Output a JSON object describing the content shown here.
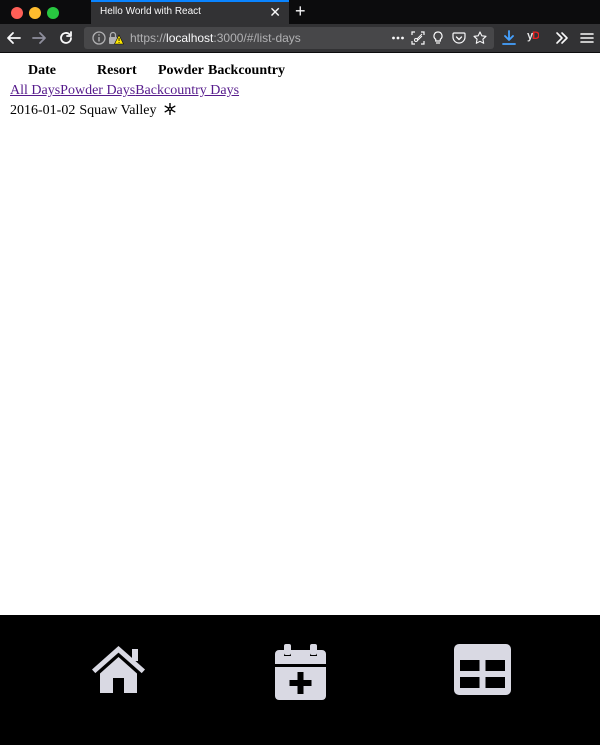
{
  "browser": {
    "tab_title": "Hello World with React",
    "url_scheme": "https://",
    "url_host": "localhost",
    "url_rest": ":3000/#/list-days",
    "addon_label": "yD"
  },
  "table": {
    "headers": [
      "Date",
      "Resort",
      "Powder",
      "Backcountry"
    ]
  },
  "filters": [
    "All Days",
    "Powder Days",
    "Backcountry Days"
  ],
  "rows": [
    {
      "date": "2016-01-02",
      "resort": "Squaw Valley",
      "powder_icon": "snowflake-icon"
    }
  ],
  "bottom_nav": {
    "icons": [
      "home-icon",
      "calendar-plus-icon",
      "table-icon"
    ],
    "icon_color": "#d9d9e3"
  }
}
